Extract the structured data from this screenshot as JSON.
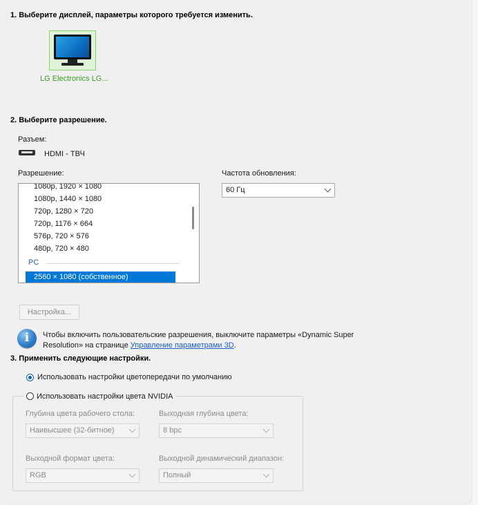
{
  "section1": {
    "title": "1. Выберите дисплей, параметры которого требуется изменить."
  },
  "display": {
    "name": "LG Electronics LG..."
  },
  "section2": {
    "title": "2. Выберите разрешение."
  },
  "connector": {
    "label": "Разъем:",
    "value": "HDMI - ТВЧ"
  },
  "resolution": {
    "label": "Разрешение:",
    "items": [
      "1080p, 1920 × 1080",
      "1080p, 1440 × 1080",
      "720p, 1280 × 720",
      "720p, 1176 × 664",
      "576p, 720 × 576",
      "480p, 720 × 480"
    ],
    "group": "PC",
    "selected": "2560 × 1080 (собственное)"
  },
  "refresh": {
    "label": "Частота обновления:",
    "value": "60 Гц"
  },
  "customize_button": "Настройка...",
  "info": {
    "text": "Чтобы включить пользовательские разрешения, выключите параметры «Dynamic Super Resolution» на странице",
    "link": "Управление параметрами 3D",
    "tail": "."
  },
  "section3": {
    "title": "3. Применить следующие настройки."
  },
  "color": {
    "option_default": "Использовать настройки цветопередачи по умолчанию",
    "option_nvidia": "Использовать настройки цвета NVIDIA",
    "desktop_depth_label": "Глубина цвета рабочего стола:",
    "desktop_depth_value": "Наивысшее (32-битное)",
    "output_depth_label": "Выходная глубина цвета:",
    "output_depth_value": "8 bpc",
    "output_format_label": "Выходной формат цвета:",
    "output_format_value": "RGB",
    "dynamic_range_label": "Выходной динамический диапазон:",
    "dynamic_range_value": "Полный"
  },
  "icons": [
    "monitor-icon",
    "hdmi-connector-icon",
    "info-icon",
    "chevron-down-icon"
  ]
}
